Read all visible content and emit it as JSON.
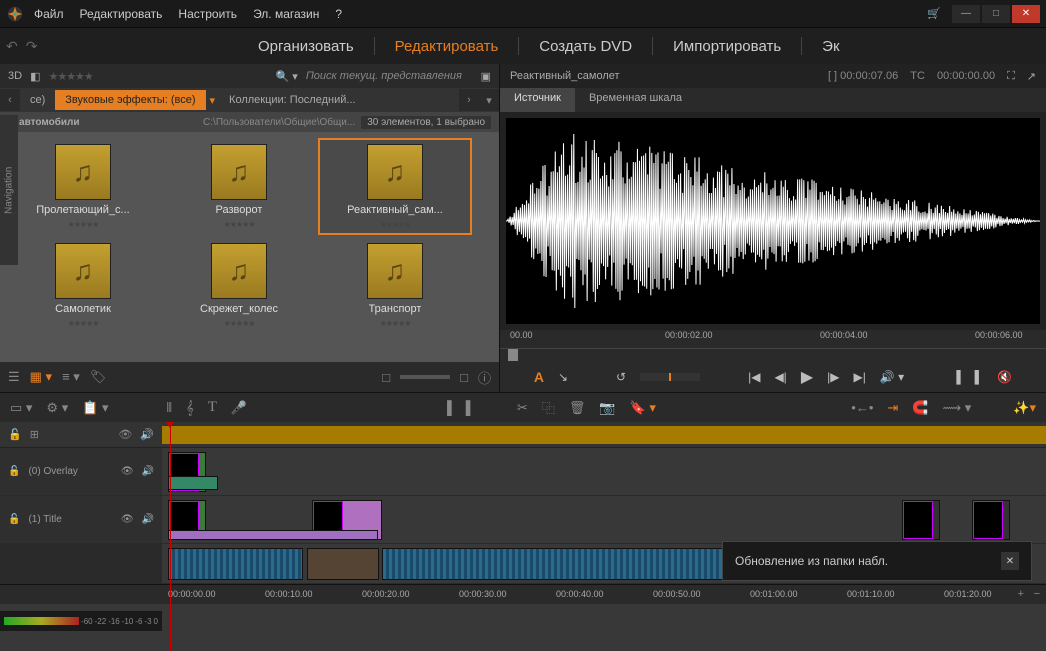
{
  "menu": {
    "file": "Файл",
    "edit": "Редактировать",
    "setup": "Настроить",
    "emagazin": "Эл. магазин"
  },
  "main_tabs": {
    "organize": "Организовать",
    "edit": "Редактировать",
    "create": "Создать DVD",
    "import": "Импортировать",
    "export": "Эк"
  },
  "search": {
    "mode3d": "3D",
    "placeholder": "Поиск текущ. представления"
  },
  "categories": {
    "prev": "‹",
    "opt0": "се)",
    "active": "Звуковые эффекты: (все)",
    "next": "Коллекции: Последний...",
    "more": "›"
  },
  "cat_header": {
    "triangle": "▸",
    "name": "автомобили",
    "path": "C:\\Пользователи\\Общие\\Общи...",
    "count": "30 элементов, 1 выбрано"
  },
  "items": [
    {
      "label": "Пролетающий_с...",
      "selected": false
    },
    {
      "label": "Разворот",
      "selected": false
    },
    {
      "label": "Реактивный_сам...",
      "selected": true
    },
    {
      "label": "Самолетик",
      "selected": false
    },
    {
      "label": "Скрежет_колес",
      "selected": false
    },
    {
      "label": "Транспорт",
      "selected": false
    }
  ],
  "preview": {
    "title": "Реактивный_самолет",
    "tc_in": "[ ] 00:00:07.06",
    "tc_label": "TC",
    "tc": "00:00:00.00",
    "tab_src": "Источник",
    "tab_tl": "Временная шкала",
    "ruler": [
      "00.00",
      "00:00:02.00",
      "00:00:04.00",
      "00:00:06.00"
    ]
  },
  "playback": {
    "mode": "A"
  },
  "tl_tracks": {
    "overlay": "(0) Overlay",
    "title": "(1) Title"
  },
  "tl_ruler": [
    "00:00:00.00",
    "00:00:10.00",
    "00:00:20.00",
    "00:00:30.00",
    "00:00:40.00",
    "00:00:50.00",
    "00:01:00.00",
    "00:01:10.00",
    "00:01:20.00"
  ],
  "audio_meter": [
    "-60",
    "-22",
    "-16",
    "-10",
    "-6",
    "-3",
    "0"
  ],
  "toast": {
    "msg": "Обновление из папки набл.",
    "close": "✕"
  },
  "nav_label": "Navigation"
}
